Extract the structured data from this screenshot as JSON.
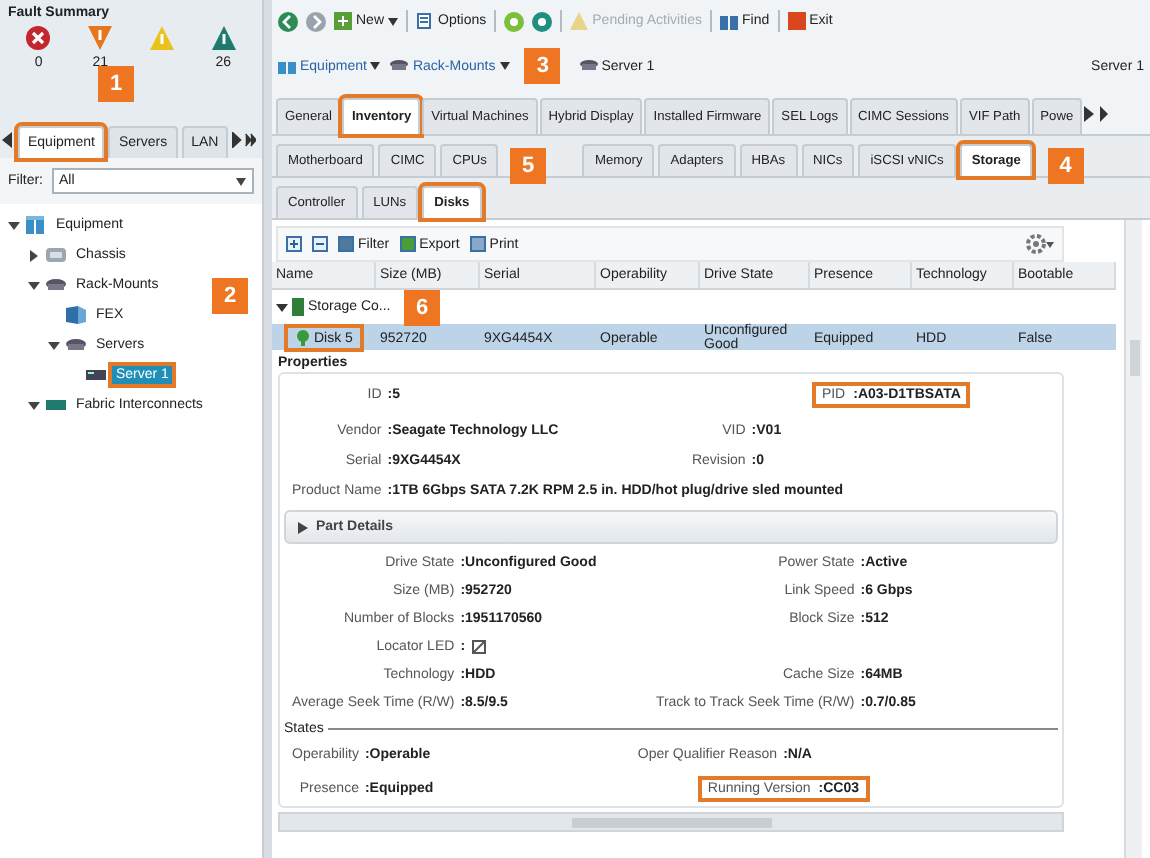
{
  "fault_summary": {
    "title": "Fault Summary",
    "items": [
      {
        "kind": "critical",
        "color": "#c4262e",
        "count": "0"
      },
      {
        "kind": "major",
        "color": "#e8761c",
        "count": "21"
      },
      {
        "kind": "minor",
        "color": "#e9c31c"
      },
      {
        "kind": "warning",
        "color": "#1d7a6c",
        "count": "26"
      }
    ]
  },
  "nav_tabs": [
    {
      "label": "Equipment",
      "selected": true,
      "highlighted": true,
      "callout": "1"
    },
    {
      "label": "Servers",
      "selected": false,
      "highlighted": false
    },
    {
      "label": "LAN",
      "selected": false,
      "highlighted": false
    }
  ],
  "filter": {
    "label": "Filter:",
    "value": "All"
  },
  "tree": [
    {
      "label": "Equipment",
      "kind": "equipment",
      "expanded": true,
      "selected": false,
      "children": [
        {
          "label": "Chassis",
          "kind": "chassis",
          "expanded": false,
          "selected": false
        },
        {
          "label": "Rack-Mounts",
          "kind": "rack",
          "expanded": true,
          "selected": false,
          "children": [
            {
              "label": "FEX",
              "kind": "fex",
              "selected": false
            },
            {
              "label": "Servers",
              "kind": "rack",
              "expanded": true,
              "selected": false,
              "children": [
                {
                  "label": "Server 1",
                  "kind": "server",
                  "selected": true,
                  "highlighted": true,
                  "callout": "2"
                }
              ]
            }
          ]
        },
        {
          "label": "Fabric Interconnects",
          "kind": "fabric",
          "expanded": true,
          "selected": false
        }
      ]
    }
  ],
  "toolbar": [
    {
      "kind": "back"
    },
    {
      "kind": "forward"
    },
    {
      "kind": "new",
      "label": "New",
      "dropdown": true
    },
    {
      "kind": "options",
      "label": "Options"
    },
    {
      "kind": "green"
    },
    {
      "kind": "teal"
    },
    {
      "kind": "pending",
      "label": "Pending Activities",
      "disabled": true
    },
    {
      "kind": "find",
      "label": "Find"
    },
    {
      "kind": "exit",
      "label": "Exit"
    }
  ],
  "breadcrumb": [
    {
      "label": "Equipment",
      "kind": "equipment",
      "dropdown": true
    },
    {
      "label": "Rack-Mounts",
      "kind": "rack",
      "dropdown": true
    },
    {
      "label": "Server 1",
      "kind": "rack",
      "dropdown": false
    }
  ],
  "context_label": "Server 1",
  "tabs": [
    {
      "label": "General",
      "selected": false,
      "highlighted": false
    },
    {
      "label": "Inventory",
      "selected": true,
      "highlighted": true,
      "callout": "3"
    },
    {
      "label": "Virtual Machines",
      "selected": false,
      "highlighted": false
    },
    {
      "label": "Hybrid Display",
      "selected": false,
      "highlighted": false
    },
    {
      "label": "Installed Firmware",
      "selected": false,
      "highlighted": false
    },
    {
      "label": "SEL Logs",
      "selected": false,
      "highlighted": false
    },
    {
      "label": "CIMC Sessions",
      "selected": false,
      "highlighted": false
    },
    {
      "label": "VIF Path",
      "selected": false,
      "highlighted": false
    },
    {
      "label": "Powe",
      "selected": false,
      "highlighted": false
    }
  ],
  "inventory_tabs": [
    {
      "label": "Motherboard",
      "selected": false,
      "highlighted": false
    },
    {
      "label": "CIMC",
      "selected": false,
      "highlighted": false
    },
    {
      "label": "CPUs",
      "selected": false,
      "highlighted": false
    },
    {
      "label": "Memory",
      "selected": false,
      "highlighted": false
    },
    {
      "label": "Adapters",
      "selected": false,
      "highlighted": false
    },
    {
      "label": "HBAs",
      "selected": false,
      "highlighted": false
    },
    {
      "label": "NICs",
      "selected": false,
      "highlighted": false
    },
    {
      "label": "iSCSI vNICs",
      "selected": false,
      "highlighted": false
    },
    {
      "label": "Storage",
      "selected": true,
      "highlighted": true,
      "callout": "4"
    }
  ],
  "storage_tabs": [
    {
      "label": "Controller",
      "selected": false,
      "highlighted": false
    },
    {
      "label": "LUNs",
      "selected": false,
      "highlighted": false
    },
    {
      "label": "Disks",
      "selected": true,
      "highlighted": true,
      "callout": "5"
    }
  ],
  "table_toolbar": [
    {
      "kind": "expand"
    },
    {
      "kind": "collapse"
    },
    {
      "kind": "filter",
      "label": "Filter"
    },
    {
      "kind": "export",
      "label": "Export"
    },
    {
      "kind": "print",
      "label": "Print"
    }
  ],
  "table": {
    "columns": [
      "Name",
      "Size (MB)",
      "Serial",
      "Operability",
      "Drive State",
      "Presence",
      "Technology",
      "Bootable"
    ],
    "rows": [
      {
        "kind": "group",
        "expanded": true,
        "selected": false,
        "cells": [
          "Storage Co..."
        ]
      },
      {
        "kind": "disk",
        "selected": true,
        "highlighted": true,
        "callout": "6",
        "cells": [
          "Disk 5",
          "952720",
          "9XG4454X",
          "Operable",
          "Unconfigured Good",
          "Equipped",
          "HDD",
          "False"
        ]
      }
    ]
  },
  "properties": {
    "title": "Properties",
    "rows": [
      {
        "kind": "pair",
        "items": [
          {
            "label": "ID",
            "value": ":5"
          },
          {
            "label": "PID",
            "value": ":A03-D1TBSATA",
            "highlighted": true
          }
        ]
      },
      {
        "kind": "pair",
        "items": [
          {
            "label": "Vendor",
            "value": ":Seagate Technology LLC"
          },
          {
            "label": "VID",
            "value": ":V01"
          }
        ]
      },
      {
        "kind": "pair",
        "items": [
          {
            "label": "Serial",
            "value": ":9XG4454X"
          },
          {
            "label": "Revision",
            "value": ":0"
          }
        ]
      },
      {
        "kind": "wide",
        "items": [
          {
            "label": "Product Name",
            "value": ":1TB 6Gbps SATA 7.2K RPM 2.5 in. HDD/hot plug/drive sled mounted"
          }
        ]
      }
    ],
    "part_details": {
      "label": "Part Details",
      "expanded": false
    },
    "details": [
      {
        "items": [
          {
            "label": "Drive State",
            "value": ":Unconfigured Good"
          },
          {
            "label": "Power State",
            "value": ":Active"
          }
        ]
      },
      {
        "items": [
          {
            "label": "Size (MB)",
            "value": ":952720"
          },
          {
            "label": "Link Speed",
            "value": ":6 Gbps"
          }
        ]
      },
      {
        "items": [
          {
            "label": "Number of Blocks",
            "value": ":1951170560"
          },
          {
            "label": "Block Size",
            "value": ":512"
          }
        ]
      },
      {
        "items": [
          {
            "label": "Locator LED",
            "value": ":",
            "kind": "led"
          }
        ]
      },
      {
        "items": [
          {
            "label": "Technology",
            "value": ":HDD"
          },
          {
            "label": "Cache Size",
            "value": ":64MB"
          }
        ]
      },
      {
        "items": [
          {
            "label": "Average Seek Time (R/W)",
            "value": ":8.5/9.5"
          },
          {
            "label": "Track to Track Seek Time (R/W)",
            "value": ":0.7/0.85"
          }
        ]
      }
    ],
    "states": {
      "title": "States",
      "rows": [
        {
          "items": [
            {
              "label": "Operability",
              "value": ":Operable"
            },
            {
              "label": "Oper Qualifier Reason",
              "value": ":N/A"
            }
          ]
        },
        {
          "items": [
            {
              "label": "Presence",
              "value": ":Equipped"
            },
            {
              "label": "Running Version",
              "value": ":CC03",
              "highlighted": true
            }
          ]
        }
      ]
    }
  }
}
